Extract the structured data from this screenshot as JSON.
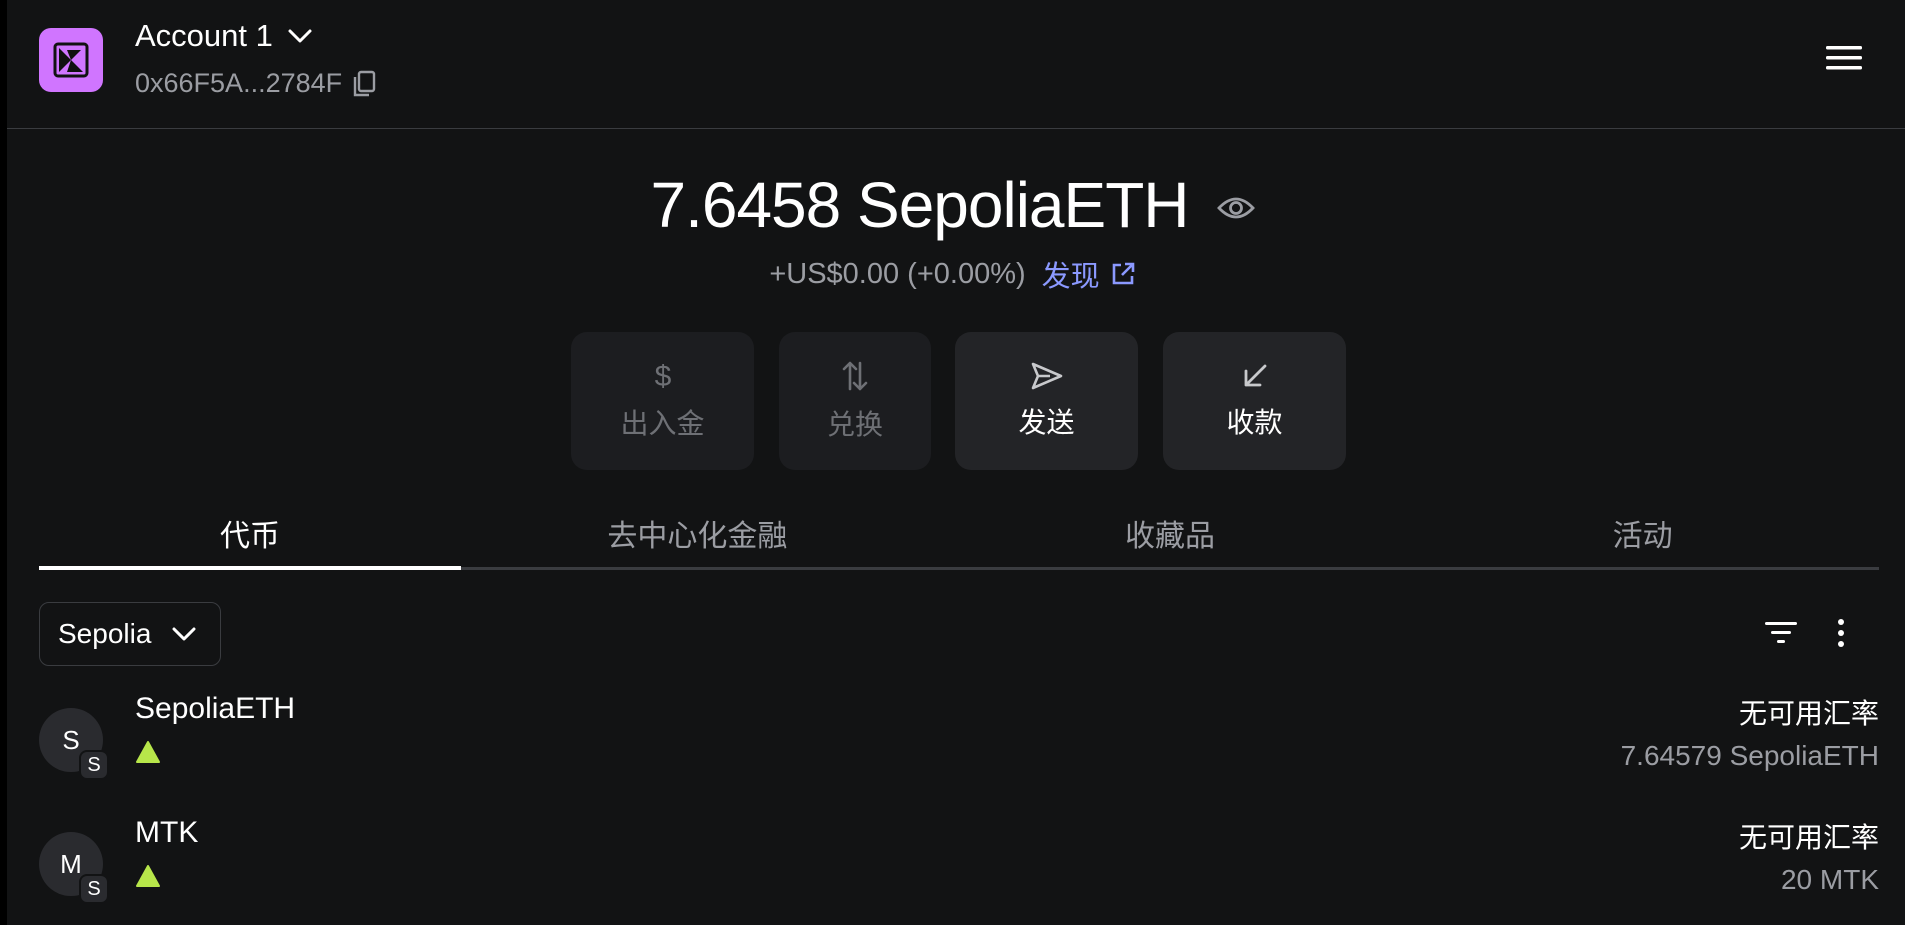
{
  "header": {
    "account_name": "Account 1",
    "address": "0x66F5A...2784F"
  },
  "balance": {
    "amount": "7.6458 SepoliaETH",
    "change": "+US$0.00 (+0.00%)",
    "discover_label": "发现"
  },
  "actions": [
    {
      "label": "出入金",
      "icon": "dollar-icon",
      "disabled": true
    },
    {
      "label": "兑换",
      "icon": "swap-icon",
      "disabled": true
    },
    {
      "label": "发送",
      "icon": "send-icon",
      "disabled": false
    },
    {
      "label": "收款",
      "icon": "receive-icon",
      "disabled": false
    }
  ],
  "tabs": [
    {
      "label": "代币",
      "active": true
    },
    {
      "label": "去中心化金融",
      "active": false
    },
    {
      "label": "收藏品",
      "active": false
    },
    {
      "label": "活动",
      "active": false
    }
  ],
  "network_filter": {
    "selected": "Sepolia"
  },
  "tokens": [
    {
      "avatar_letter": "S",
      "network_badge": "S",
      "name": "SepoliaETH",
      "rate": "无可用汇率",
      "balance": "7.64579 SepoliaETH"
    },
    {
      "avatar_letter": "M",
      "network_badge": "S",
      "name": "MTK",
      "rate": "无可用汇率",
      "balance": "20 MTK"
    }
  ],
  "colors": {
    "background": "#121314",
    "logo": "#d075ff",
    "link": "#8b99ff",
    "trend_up": "#b7e64a"
  }
}
